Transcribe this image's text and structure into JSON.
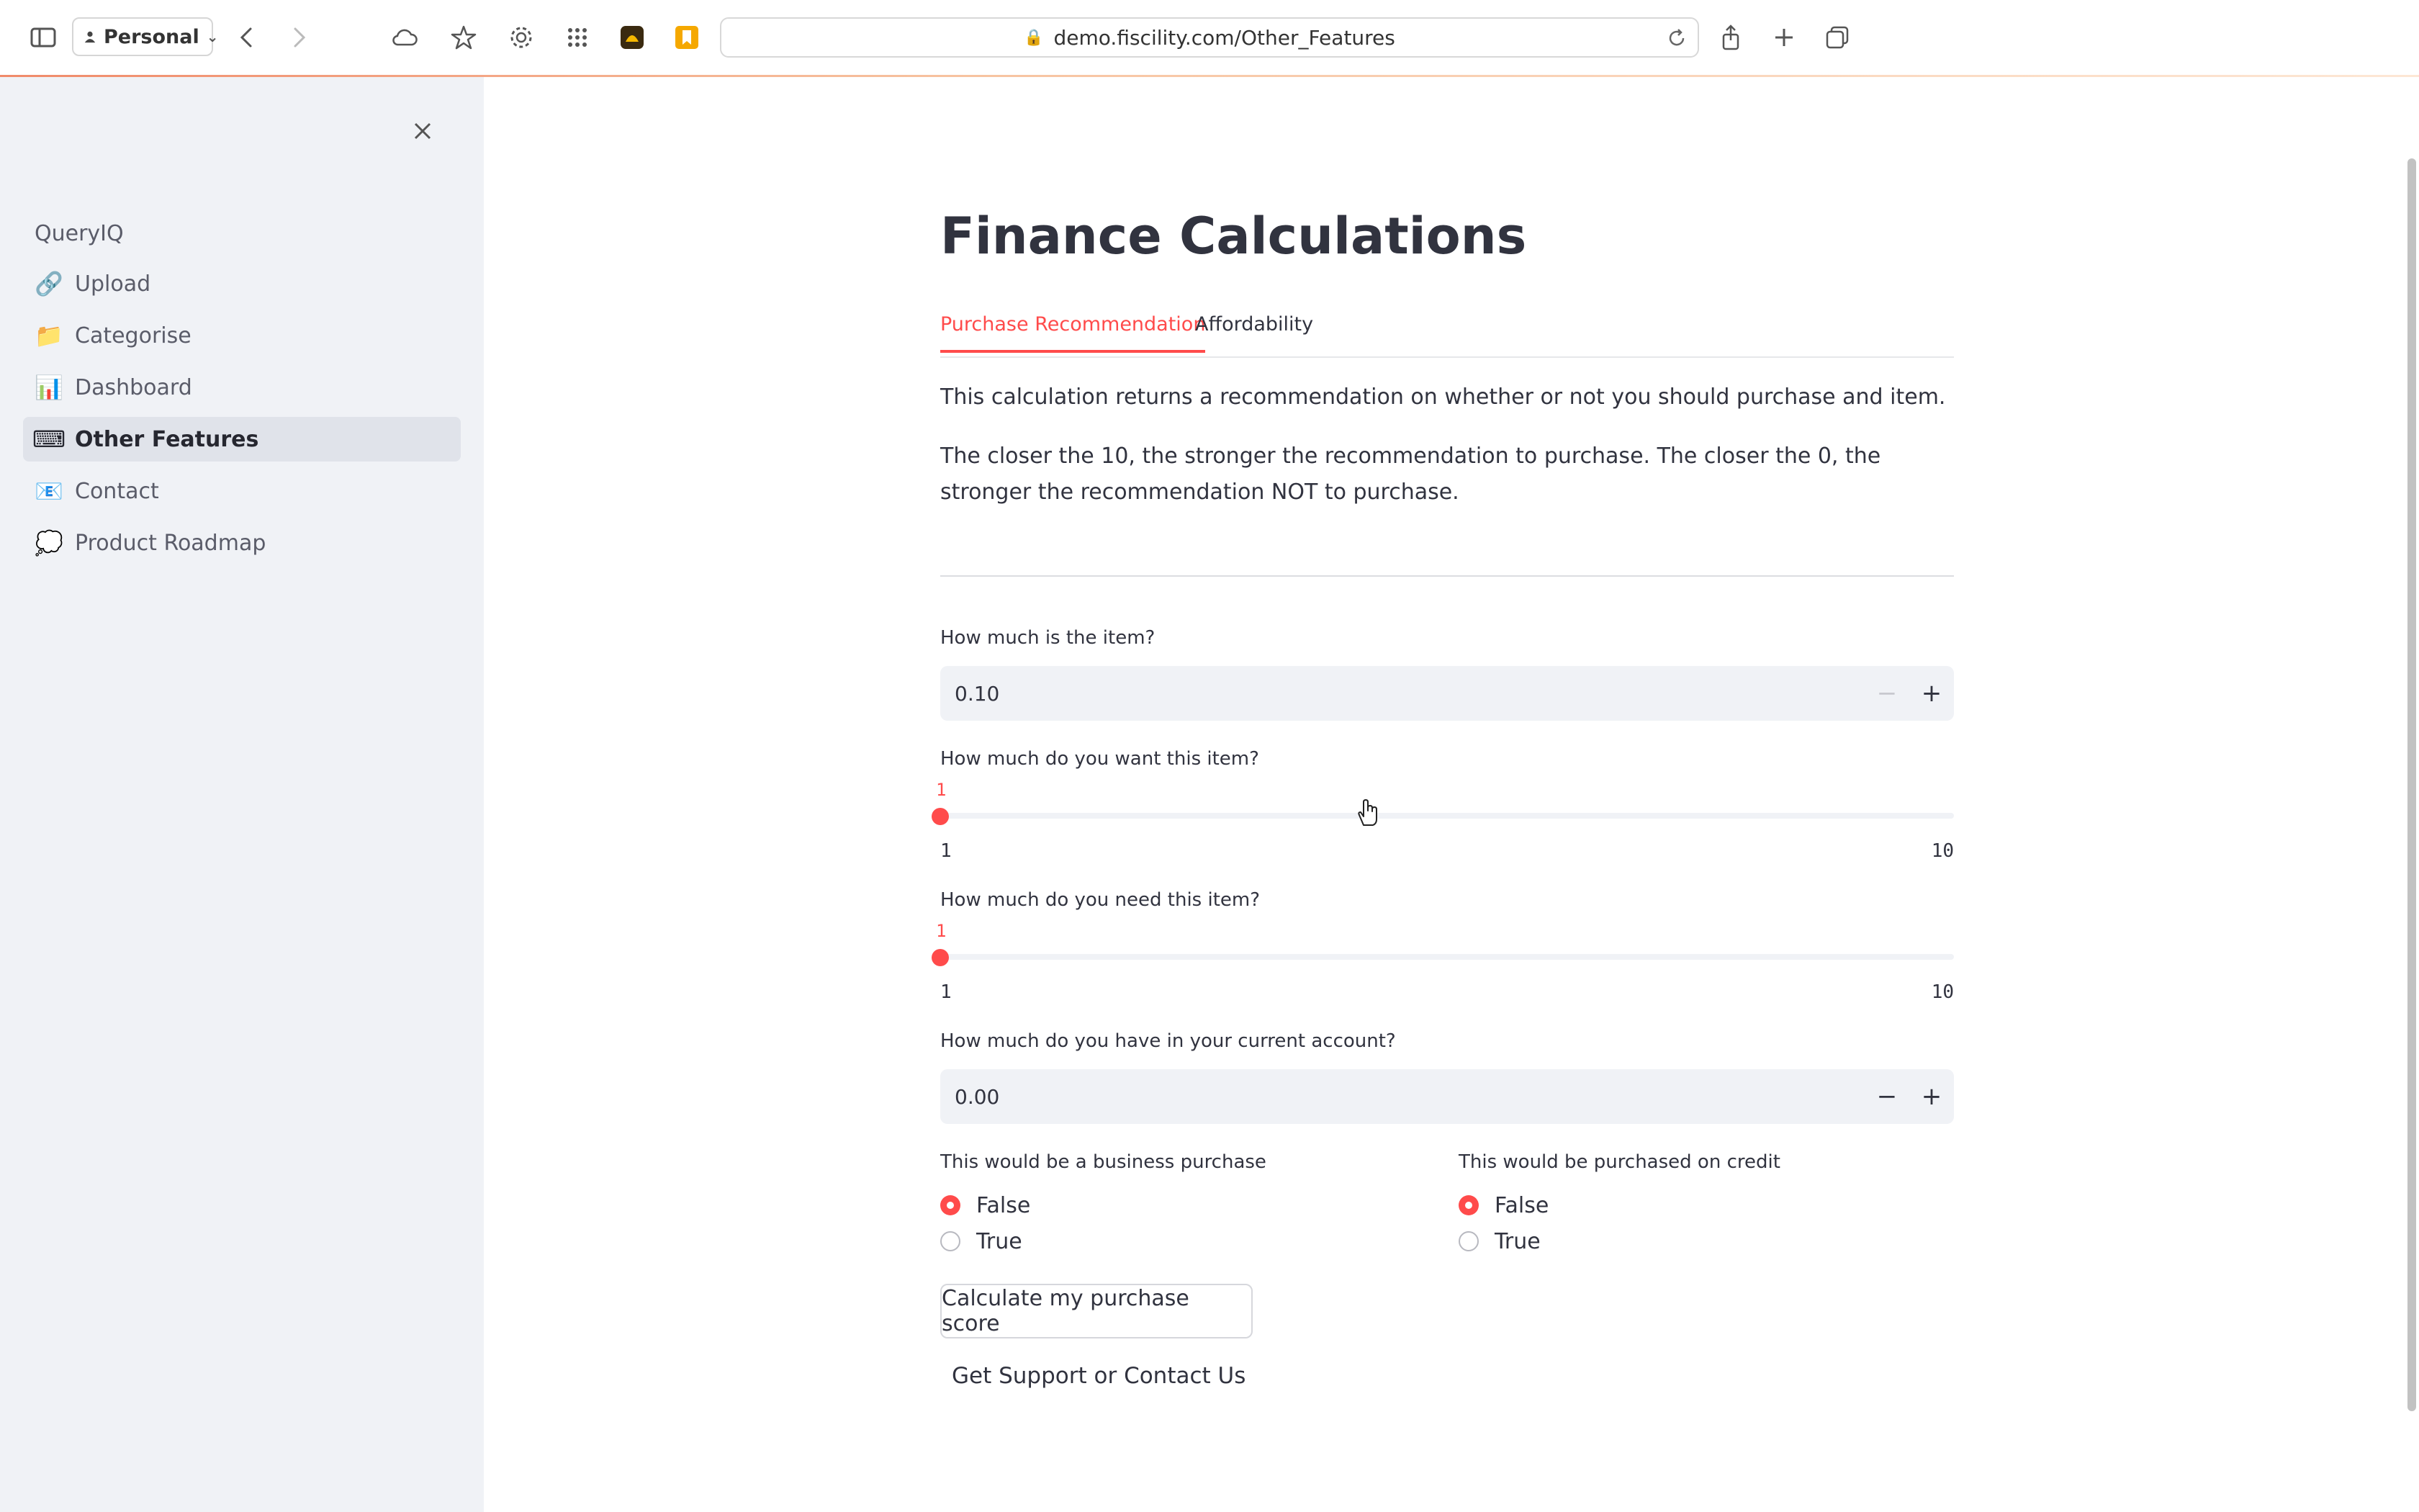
{
  "browser": {
    "profile_label": "Personal",
    "url": "demo.fiscility.com/Other_Features"
  },
  "sidebar": {
    "app_name": "QueryIQ",
    "items": [
      {
        "label": "Upload",
        "icon": "🔗",
        "icon_name": "link-icon",
        "active": false
      },
      {
        "label": "Categorise",
        "icon": "📁",
        "icon_name": "folder-icon",
        "active": false
      },
      {
        "label": "Dashboard",
        "icon": "📊",
        "icon_name": "bar-chart-icon",
        "active": false
      },
      {
        "label": "Other Features",
        "icon": "⌨",
        "icon_name": "keyboard-icon",
        "active": true
      },
      {
        "label": "Contact",
        "icon": "📧",
        "icon_name": "email-icon",
        "active": false
      },
      {
        "label": "Product Roadmap",
        "icon": "💭",
        "icon_name": "thought-bubble-icon",
        "active": false
      }
    ]
  },
  "main": {
    "title": "Finance Calculations",
    "tabs": [
      {
        "label": "Purchase Recommendation",
        "active": true
      },
      {
        "label": "Affordability",
        "active": false
      }
    ],
    "intro": "This calculation returns a recommendation on whether or not you should purchase and item.",
    "explanation": "The closer the 10, the stronger the recommendation to purchase. The closer the 0, the stronger the recommendation NOT to purchase.",
    "item_price": {
      "label": "How much is the item?",
      "value": "0.10",
      "minus": "−",
      "plus": "+"
    },
    "want_slider": {
      "label": "How much do you want this item?",
      "value": 1,
      "min": 1,
      "max": 10,
      "value_text": "1",
      "min_text": "1",
      "max_text": "10"
    },
    "need_slider": {
      "label": "How much do you need this item?",
      "value": 1,
      "min": 1,
      "max": 10,
      "value_text": "1",
      "min_text": "1",
      "max_text": "10"
    },
    "current_account": {
      "label": "How much do you have in your current account?",
      "value": "0.00",
      "minus": "−",
      "plus": "+"
    },
    "business_purchase": {
      "label": "This would be a business purchase",
      "options": [
        "False",
        "True"
      ],
      "selected": "False"
    },
    "credit_purchase": {
      "label": "This would be purchased on credit",
      "options": [
        "False",
        "True"
      ],
      "selected": "False"
    },
    "calculate_button": "Calculate my purchase score",
    "support_link": "Get Support or Contact Us"
  },
  "colors": {
    "accent": "#ff4b4b",
    "sidebar_bg": "#f0f2f6",
    "text": "#31333f"
  }
}
